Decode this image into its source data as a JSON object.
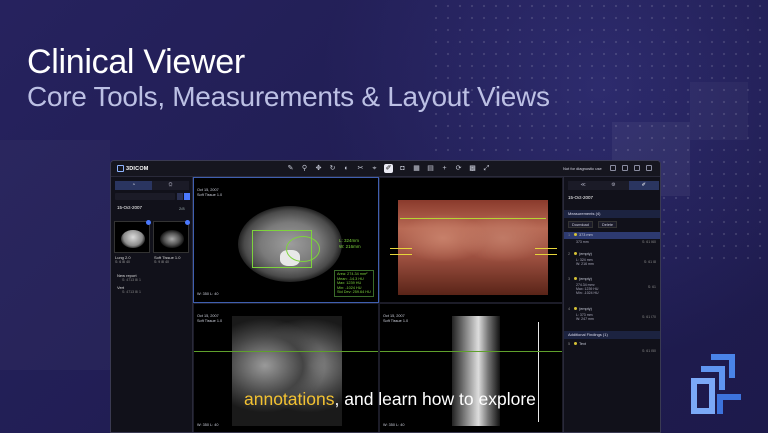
{
  "hero": {
    "title": "Clinical Viewer",
    "subtitle": "Core Tools, Measurements & Layout Views"
  },
  "app": {
    "logo": "3DICOM",
    "diagnostic_note": "Not for diagnostic use"
  },
  "left_panel": {
    "study_date": "15-Oct-2007",
    "series_count": "2/8",
    "thumbnails": [
      {
        "label": "Lung 2.0",
        "sub": "S: 6  ⊞ 40"
      },
      {
        "label": "Soft Tissue 1.0",
        "sub": "S: 9  ⊞ 40"
      }
    ],
    "reports": [
      {
        "label": "New report",
        "sub": "S: 4713  ⊞ 1"
      },
      {
        "label": "Vert",
        "sub": "S: 4713  ⊞ 1"
      }
    ]
  },
  "viewports": {
    "vp1": {
      "date": "Oct 15, 2007",
      "series": "Soft Tissue 1.0",
      "length_l": "L: 324mm",
      "width_w": "W: 216mm",
      "stats": [
        "Area: 274.34 mm²",
        "Mean: -14.3 HU",
        "Max: 1239 HU",
        "Min: -1024 HU",
        "Std Dev: 259.64 HU"
      ],
      "footer": "W: 350  L: 40"
    },
    "vp3": {
      "date": "Oct 15, 2007",
      "series": "Soft Tissue 1.0",
      "footer": "W: 350  L: 40"
    },
    "vp4": {
      "date": "Oct 15, 2007",
      "series": "Soft Tissue 1.0",
      "footer": "W: 350  L: 40"
    }
  },
  "right_panel": {
    "study_date": "15-Oct-2007",
    "measurements_header": "Measurements (4)",
    "buttons": {
      "download": "Download",
      "delete": "Delete"
    },
    "rows": [
      {
        "idx": "1",
        "name": "373 mm",
        "detail": "373 mm",
        "right": "S: 61 I60"
      },
      {
        "idx": "2",
        "name": "(empty)",
        "detail": "L: 324 mm\nW: 216 mm",
        "right": "S: 61 I8"
      },
      {
        "idx": "3",
        "name": "(empty)",
        "detail": "274.34 mm²\nMax: 1239 HU\nMin: -1024 HU",
        "right": "S: 61"
      },
      {
        "idx": "4",
        "name": "(empty)",
        "detail": "L: 373 mm\nW: 247 mm",
        "right": "S: 61 I70"
      }
    ],
    "additional_header": "Additional Findings (1)",
    "findings": [
      {
        "idx": "5",
        "name": "Text",
        "right": "S: 61 I50"
      }
    ]
  },
  "caption": {
    "highlight": "annotations",
    "rest": ", and learn how to explore"
  },
  "colors": {
    "background": "#221f56",
    "accent": "#f3c232",
    "measurement": "#7dd33c"
  }
}
